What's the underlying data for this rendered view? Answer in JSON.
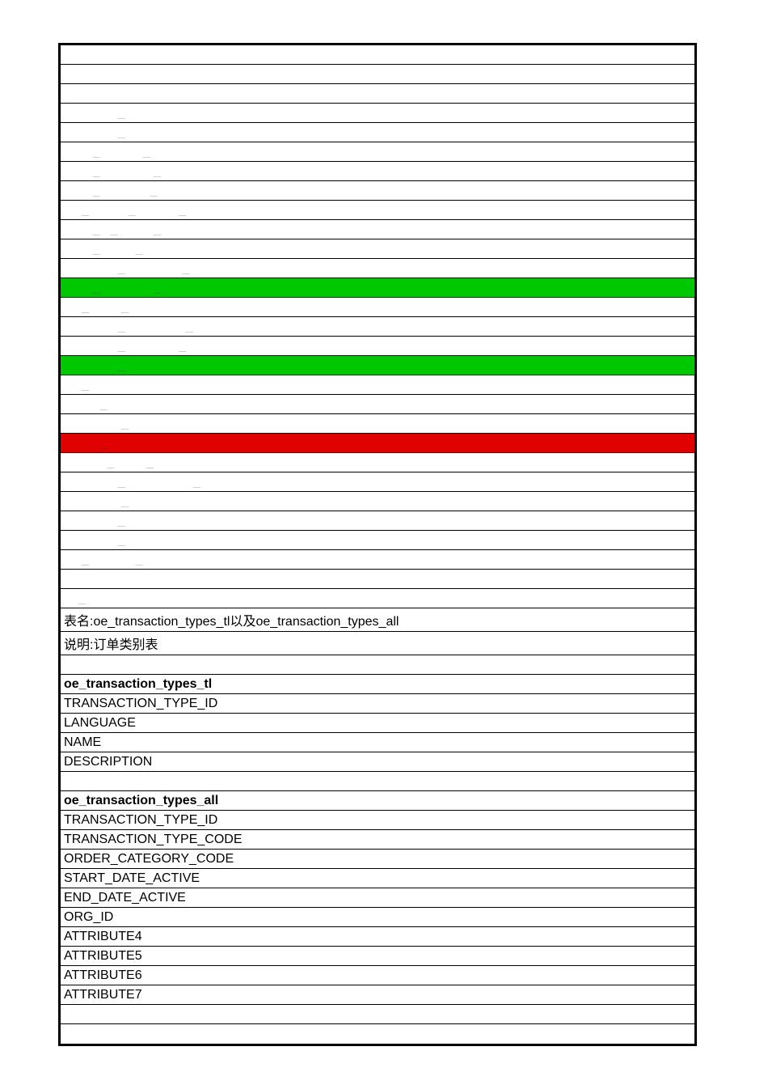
{
  "rows": [
    {
      "text": "",
      "class": ""
    },
    {
      "text": "",
      "class": ""
    },
    {
      "text": "",
      "class": ""
    },
    {
      "text": "               _",
      "class": "underscore-row"
    },
    {
      "text": "               _",
      "class": "underscore-row"
    },
    {
      "text": "        _            _",
      "class": "underscore-row"
    },
    {
      "text": "        _               _",
      "class": "underscore-row"
    },
    {
      "text": "        _              _",
      "class": "underscore-row"
    },
    {
      "text": "     _           _            _",
      "class": "underscore-row"
    },
    {
      "text": "        _   _          _",
      "class": "underscore-row"
    },
    {
      "text": "        _          _",
      "class": "underscore-row"
    },
    {
      "text": "               _                _",
      "class": "underscore-row"
    },
    {
      "text": "        _               _",
      "class": "underscore-row highlight-green"
    },
    {
      "text": "     _         _",
      "class": "underscore-row"
    },
    {
      "text": "               _                 _",
      "class": "underscore-row"
    },
    {
      "text": "               _               _",
      "class": "underscore-row"
    },
    {
      "text": "               _",
      "class": "underscore-row highlight-green"
    },
    {
      "text": "     _",
      "class": "underscore-row"
    },
    {
      "text": "          _",
      "class": "underscore-row"
    },
    {
      "text": "                _",
      "class": "underscore-row"
    },
    {
      "text": "          _",
      "class": "underscore-row highlight-red"
    },
    {
      "text": "            _         _",
      "class": "underscore-row"
    },
    {
      "text": "               _                   _",
      "class": "underscore-row"
    },
    {
      "text": "                _",
      "class": "underscore-row"
    },
    {
      "text": "               _",
      "class": "underscore-row"
    },
    {
      "text": "               _",
      "class": "underscore-row"
    },
    {
      "text": "     _             _",
      "class": "underscore-row"
    },
    {
      "text": "",
      "class": ""
    },
    {
      "text": "    _",
      "class": "underscore-row"
    },
    {
      "text": "表名:oe_transaction_types_tl以及oe_transaction_types_all",
      "class": "overflow"
    },
    {
      "text": "说明:订单类别表",
      "class": ""
    },
    {
      "text": "",
      "class": ""
    },
    {
      "text": "oe_transaction_types_tl",
      "class": "bold"
    },
    {
      "text": "TRANSACTION_TYPE_ID",
      "class": ""
    },
    {
      "text": "LANGUAGE",
      "class": ""
    },
    {
      "text": "NAME",
      "class": ""
    },
    {
      "text": "DESCRIPTION",
      "class": ""
    },
    {
      "text": "",
      "class": ""
    },
    {
      "text": "oe_transaction_types_all",
      "class": "bold"
    },
    {
      "text": "TRANSACTION_TYPE_ID",
      "class": ""
    },
    {
      "text": "TRANSACTION_TYPE_CODE",
      "class": ""
    },
    {
      "text": "ORDER_CATEGORY_CODE",
      "class": ""
    },
    {
      "text": "START_DATE_ACTIVE",
      "class": ""
    },
    {
      "text": "END_DATE_ACTIVE",
      "class": ""
    },
    {
      "text": "ORG_ID",
      "class": ""
    },
    {
      "text": "ATTRIBUTE4",
      "class": ""
    },
    {
      "text": "ATTRIBUTE5",
      "class": ""
    },
    {
      "text": "ATTRIBUTE6",
      "class": ""
    },
    {
      "text": "ATTRIBUTE7",
      "class": ""
    },
    {
      "text": "",
      "class": ""
    },
    {
      "text": "",
      "class": ""
    }
  ]
}
